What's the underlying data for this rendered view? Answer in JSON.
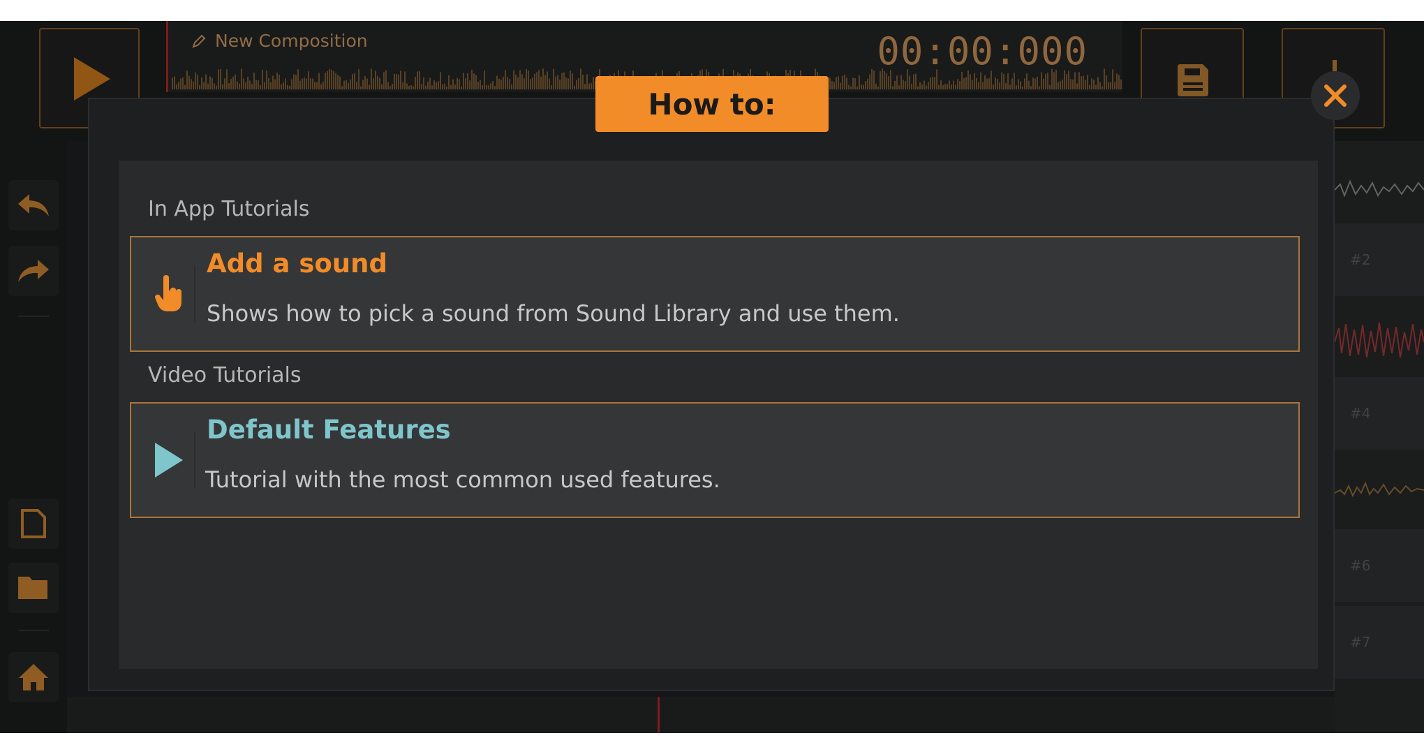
{
  "composition": {
    "title": "New Composition",
    "timecode": "00:00:000"
  },
  "tracks": [
    "#2",
    "#4",
    "#6",
    "#7"
  ],
  "modal": {
    "title": "How to:",
    "sections": [
      {
        "label": "In App Tutorials",
        "items": [
          {
            "title": "Add a sound",
            "description": "Shows how to pick a sound from Sound Library and use them.",
            "icon": "hand-pointer-icon"
          }
        ]
      },
      {
        "label": "Video Tutorials",
        "items": [
          {
            "title": "Default Features",
            "description": "Tutorial with the most common used features.",
            "icon": "play-icon"
          }
        ]
      }
    ]
  },
  "colors": {
    "accent": "#f28c28",
    "video_title": "#7fc6cc",
    "item_border": "#a9773b",
    "background": "#1e1f20"
  }
}
